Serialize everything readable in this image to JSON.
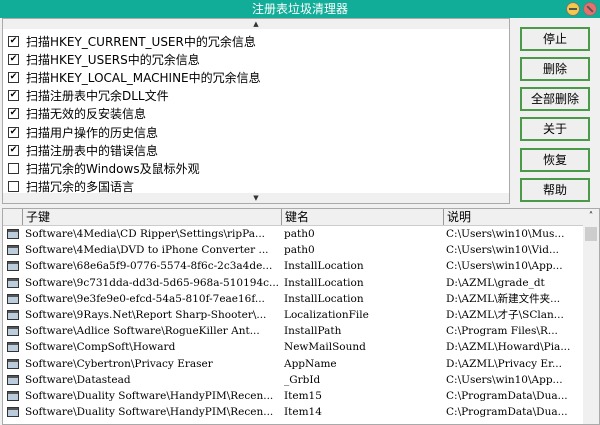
{
  "title": "注册表垃圾清理器",
  "options": [
    {
      "label": "扫描HKEY_CURRENT_USER中的冗余信息",
      "checked": true
    },
    {
      "label": "扫描HKEY_USERS中的冗余信息",
      "checked": true
    },
    {
      "label": "扫描HKEY_LOCAL_MACHINE中的冗余信息",
      "checked": true
    },
    {
      "label": "扫描注册表中冗余DLL文件",
      "checked": true
    },
    {
      "label": "扫描无效的反安装信息",
      "checked": true
    },
    {
      "label": "扫描用户操作的历史信息",
      "checked": true
    },
    {
      "label": "扫描注册表中的错误信息",
      "checked": true
    },
    {
      "label": "扫描冗余的Windows及鼠标外观",
      "checked": false
    },
    {
      "label": "扫描冗余的多国语言",
      "checked": false
    }
  ],
  "buttons": {
    "stop": "停止",
    "delete": "删除",
    "delete_all": "全部删除",
    "about": "关于",
    "restore": "恢复",
    "help": "帮助"
  },
  "table": {
    "headers": [
      "子键",
      "键名",
      "说明"
    ],
    "rows": [
      [
        "Software\\4Media\\CD Ripper\\Settings\\ripPa...",
        "path0",
        "C:\\Users\\win10\\Mus..."
      ],
      [
        "Software\\4Media\\DVD to iPhone Converter ...",
        "path0",
        "C:\\Users\\win10\\Vid..."
      ],
      [
        "Software\\68e6a5f9-0776-5574-8f6c-2c3a4de...",
        "InstallLocation",
        "C:\\Users\\win10\\App..."
      ],
      [
        "Software\\9c731dda-dd3d-5d65-968a-510194c...",
        "InstallLocation",
        "D:\\AZML\\grade_dt"
      ],
      [
        "Software\\9e3fe9e0-efcd-54a5-810f-7eae16f...",
        "InstallLocation",
        "D:\\AZML\\新建文件夹..."
      ],
      [
        "Software\\9Rays.Net\\Report Sharp-Shooter\\...",
        "LocalizationFile",
        "D:\\AZML\\才子\\SClan..."
      ],
      [
        "Software\\Adlice Software\\RogueKiller Ant...",
        "InstallPath",
        "C:\\Program Files\\R..."
      ],
      [
        "Software\\CompSoft\\Howard",
        "NewMailSound",
        "D:\\AZML\\Howard\\Pia..."
      ],
      [
        "Software\\Cybertron\\Privacy Eraser",
        "AppName",
        "D:\\AZML\\Privacy Er..."
      ],
      [
        "Software\\Datastead",
        "_GrbId",
        "C:\\Users\\win10\\App..."
      ],
      [
        "Software\\Duality Software\\HandyPIM\\Recen...",
        "Item15",
        "C:\\ProgramData\\Dua..."
      ],
      [
        "Software\\Duality Software\\HandyPIM\\Recen...",
        "Item14",
        "C:\\ProgramData\\Dua..."
      ]
    ]
  }
}
